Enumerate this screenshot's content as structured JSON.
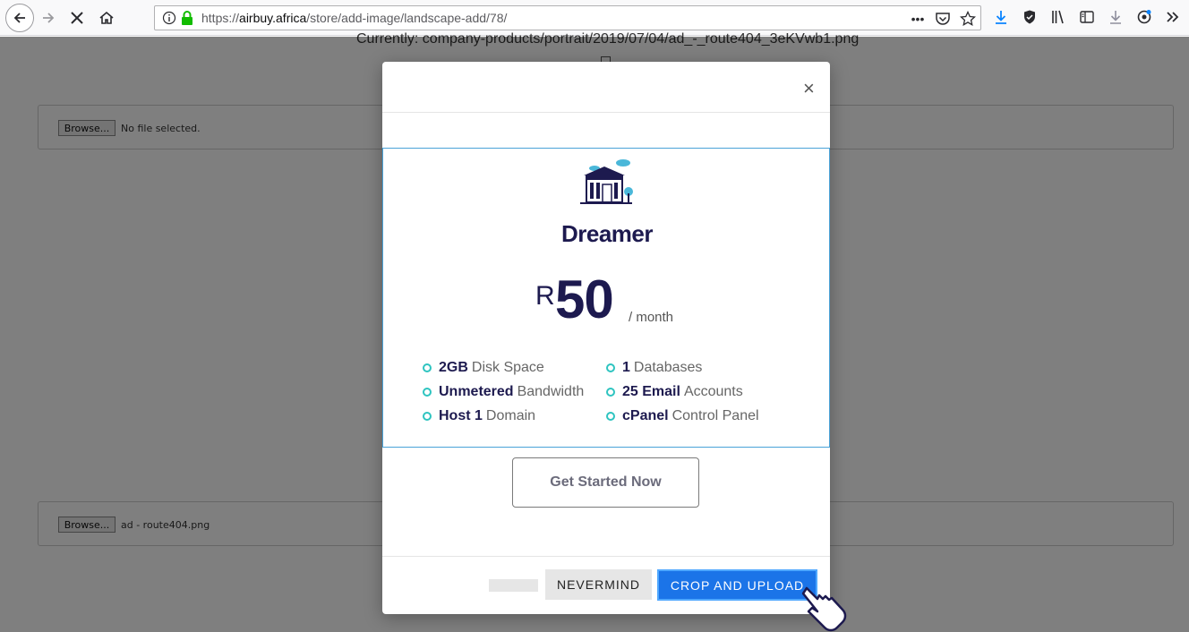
{
  "browser": {
    "url_prefix": "https://",
    "url_domain": "airbuy.africa",
    "url_path": "/store/add-image/landscape-add/78/",
    "icons": [
      "back-icon",
      "forward-icon",
      "stop-icon",
      "home-icon",
      "info-icon",
      "lock-icon",
      "more-icon",
      "pocket-icon",
      "star-icon",
      "download-icon",
      "shield-icon",
      "library-icon",
      "sidebar-icon",
      "download-arrow-icon",
      "account-icon",
      "overflow-icon"
    ]
  },
  "page": {
    "current_text": "Currently: company-products/portrait/2019/07/04/ad_-_route404_3eKVwb1.png",
    "file_input_1": {
      "button": "Browse...",
      "label": "No file selected."
    },
    "file_input_2": {
      "button": "Browse...",
      "label": "ad - route404.png"
    }
  },
  "modal": {
    "close_label": "×",
    "plan": {
      "name": "Dreamer",
      "currency": "R",
      "amount": "50",
      "period": "/ month",
      "features": [
        {
          "bold": "2GB",
          "text": "Disk Space"
        },
        {
          "bold": "1",
          "text": "Databases"
        },
        {
          "bold": "Unmetered",
          "text": "Bandwidth"
        },
        {
          "bold": "25 Email",
          "text": "Accounts"
        },
        {
          "bold": "Host 1",
          "text": "Domain"
        },
        {
          "bold": "cPanel",
          "text": "Control Panel"
        }
      ],
      "cta_label": "Get Started Now"
    },
    "nevermind_label": "NEVERMIND",
    "crop_upload_label": "CROP AND UPLOAD"
  },
  "colors": {
    "accent": "#1b74e8",
    "plan_text": "#1d1a4f",
    "feature_dot": "#2ec4c0",
    "card_border": "#4aa3d8"
  }
}
